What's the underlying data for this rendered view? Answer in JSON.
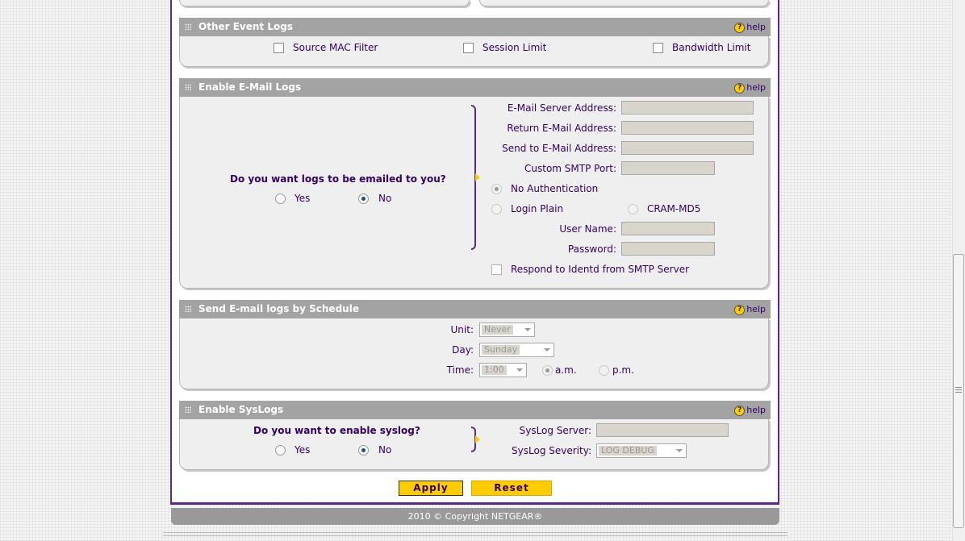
{
  "other_logs": {
    "title": "Other Event Logs",
    "help": "help",
    "items": [
      "Source MAC Filter",
      "Session Limit",
      "Bandwidth Limit"
    ]
  },
  "email_logs": {
    "title": "Enable E-Mail Logs",
    "help": "help",
    "question": "Do you want logs to be emailed to you?",
    "yes": "Yes",
    "no": "No",
    "selected": "No",
    "server_label": "E-Mail Server Address:",
    "return_label": "Return E-Mail Address:",
    "send_label": "Send to E-Mail Address:",
    "smtp_label": "Custom SMTP Port:",
    "no_auth": "No Authentication",
    "login_plain": "Login Plain",
    "cram": "CRAM-MD5",
    "user_label": "User Name:",
    "pass_label": "Password:",
    "identd": "Respond to Identd from SMTP Server"
  },
  "schedule": {
    "title": "Send E-mail logs by Schedule",
    "help": "help",
    "unit_label": "Unit:",
    "unit_value": "Never",
    "day_label": "Day:",
    "day_value": "Sunday",
    "time_label": "Time:",
    "time_value": "1:00",
    "am": "a.m.",
    "pm": "p.m."
  },
  "syslog": {
    "title": "Enable SysLogs",
    "help": "help",
    "question": "Do you want to enable syslog?",
    "yes": "Yes",
    "no": "No",
    "server_label": "SysLog Server:",
    "severity_label": "SysLog Severity:",
    "severity_value": "LOG DEBUG"
  },
  "buttons": {
    "apply": "Apply",
    "reset": "Reset"
  },
  "footer": "2010 © Copyright NETGEAR®"
}
